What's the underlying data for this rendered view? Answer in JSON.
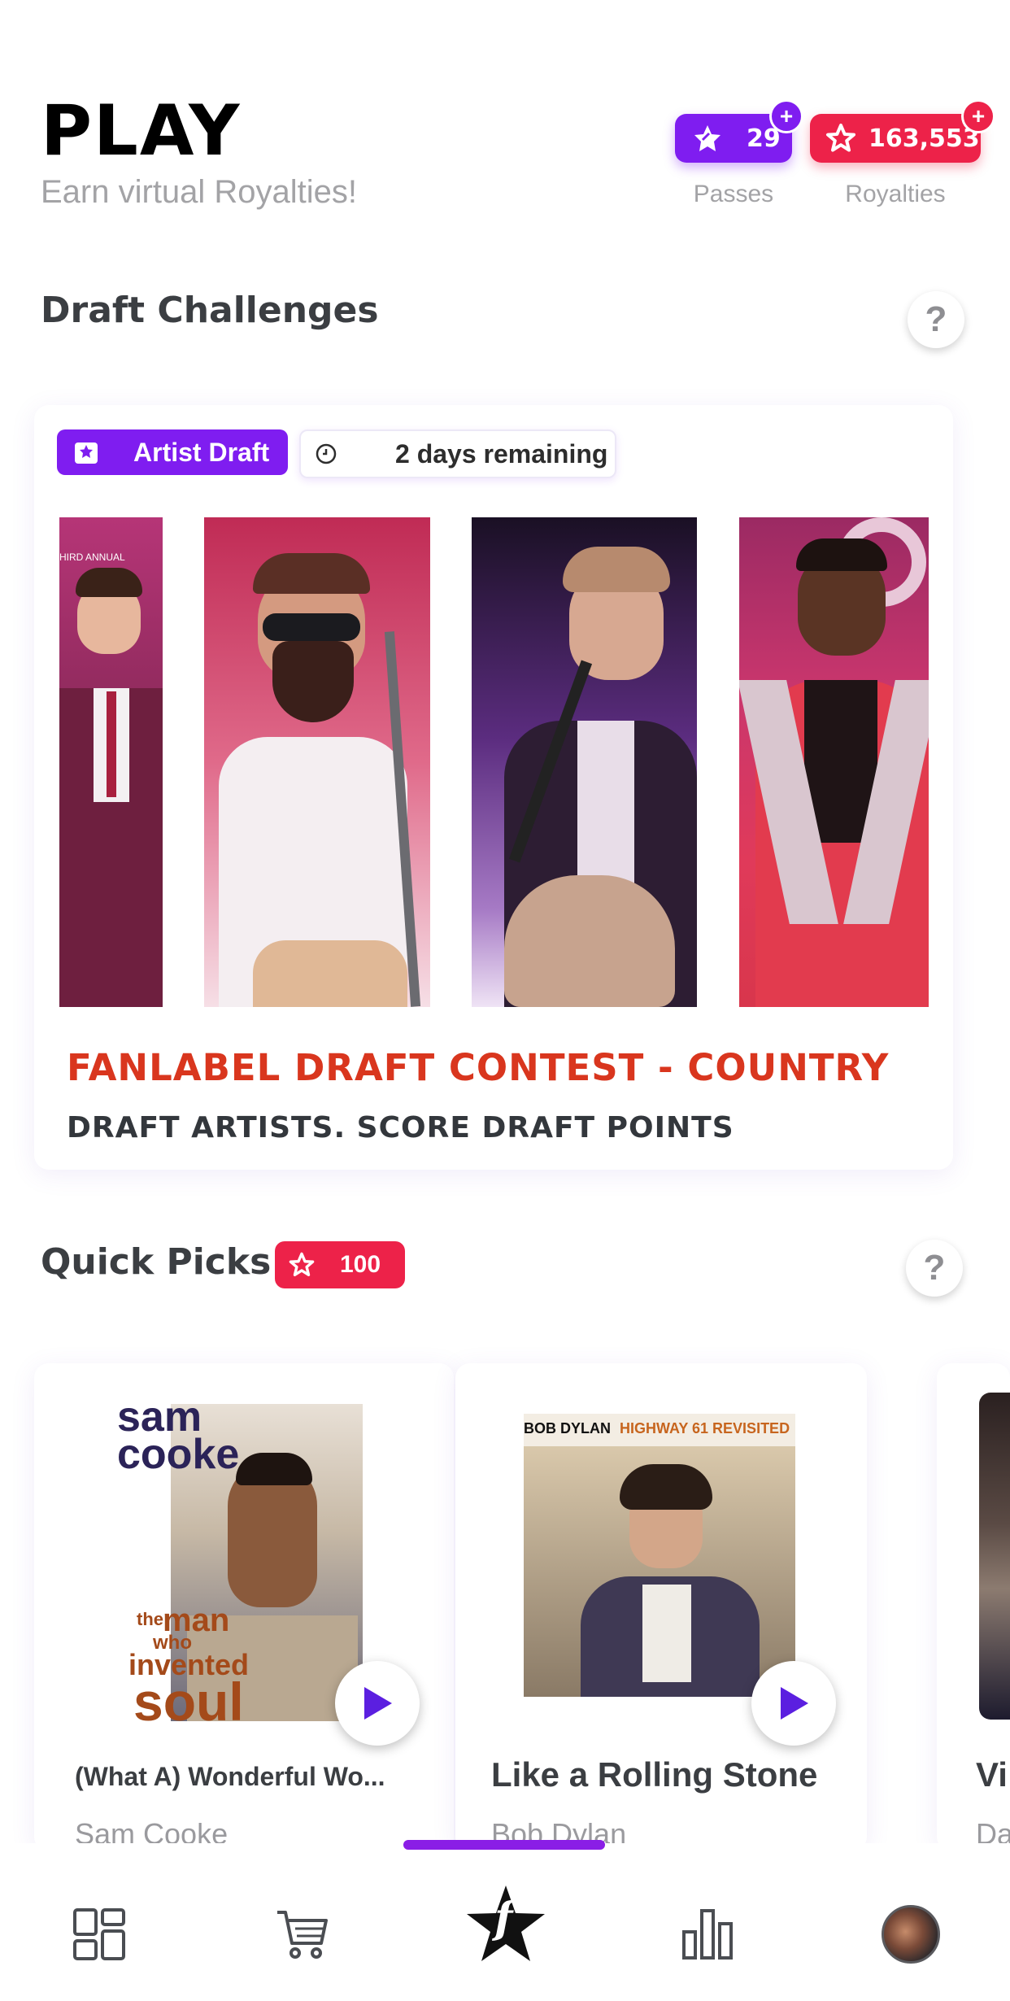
{
  "header": {
    "title": "PLAY",
    "subtitle": "Earn virtual Royalties!",
    "passes": {
      "value": "29",
      "label": "Passes"
    },
    "royalties": {
      "value": "163,553",
      "label": "Royalties"
    },
    "plus": "+"
  },
  "draft_section": {
    "title": "Draft Challenges",
    "help": "?",
    "card": {
      "tag": "Artist Draft",
      "time_remaining": "2 days remaining",
      "contest_title": "FANLABEL DRAFT CONTEST - COUNTRY",
      "contest_subtitle": "DRAFT ARTISTS. SCORE DRAFT POINTS",
      "photo_caption": "HIRD ANNUAL"
    }
  },
  "quick_picks": {
    "title": "Quick Picks",
    "badge_value": "100",
    "help": "?",
    "items": [
      {
        "title": "(What A) Wonderful Wo...",
        "artist": "Sam Cooke",
        "cover": {
          "top1": "sam",
          "top2": "cooke",
          "l1": "the",
          "l2": "man",
          "l3": "who",
          "l4": "invented",
          "l5": "soul"
        }
      },
      {
        "title": "Like a Rolling Stone",
        "artist": "Bob Dylan",
        "cover": {
          "artist": "BOB DYLAN",
          "album": "HIGHWAY 61 REVISITED"
        }
      },
      {
        "title": "Vi",
        "artist": "Da"
      }
    ]
  },
  "colors": {
    "purple": "#7f1df0",
    "red": "#ed2249",
    "contest_red": "#d9361e"
  },
  "nav": {
    "items": [
      {
        "name": "dashboard-icon"
      },
      {
        "name": "cart-icon"
      },
      {
        "name": "fanlabel-star-icon",
        "letter": "f",
        "active": true
      },
      {
        "name": "bar-chart-icon"
      },
      {
        "name": "profile-avatar"
      }
    ]
  }
}
